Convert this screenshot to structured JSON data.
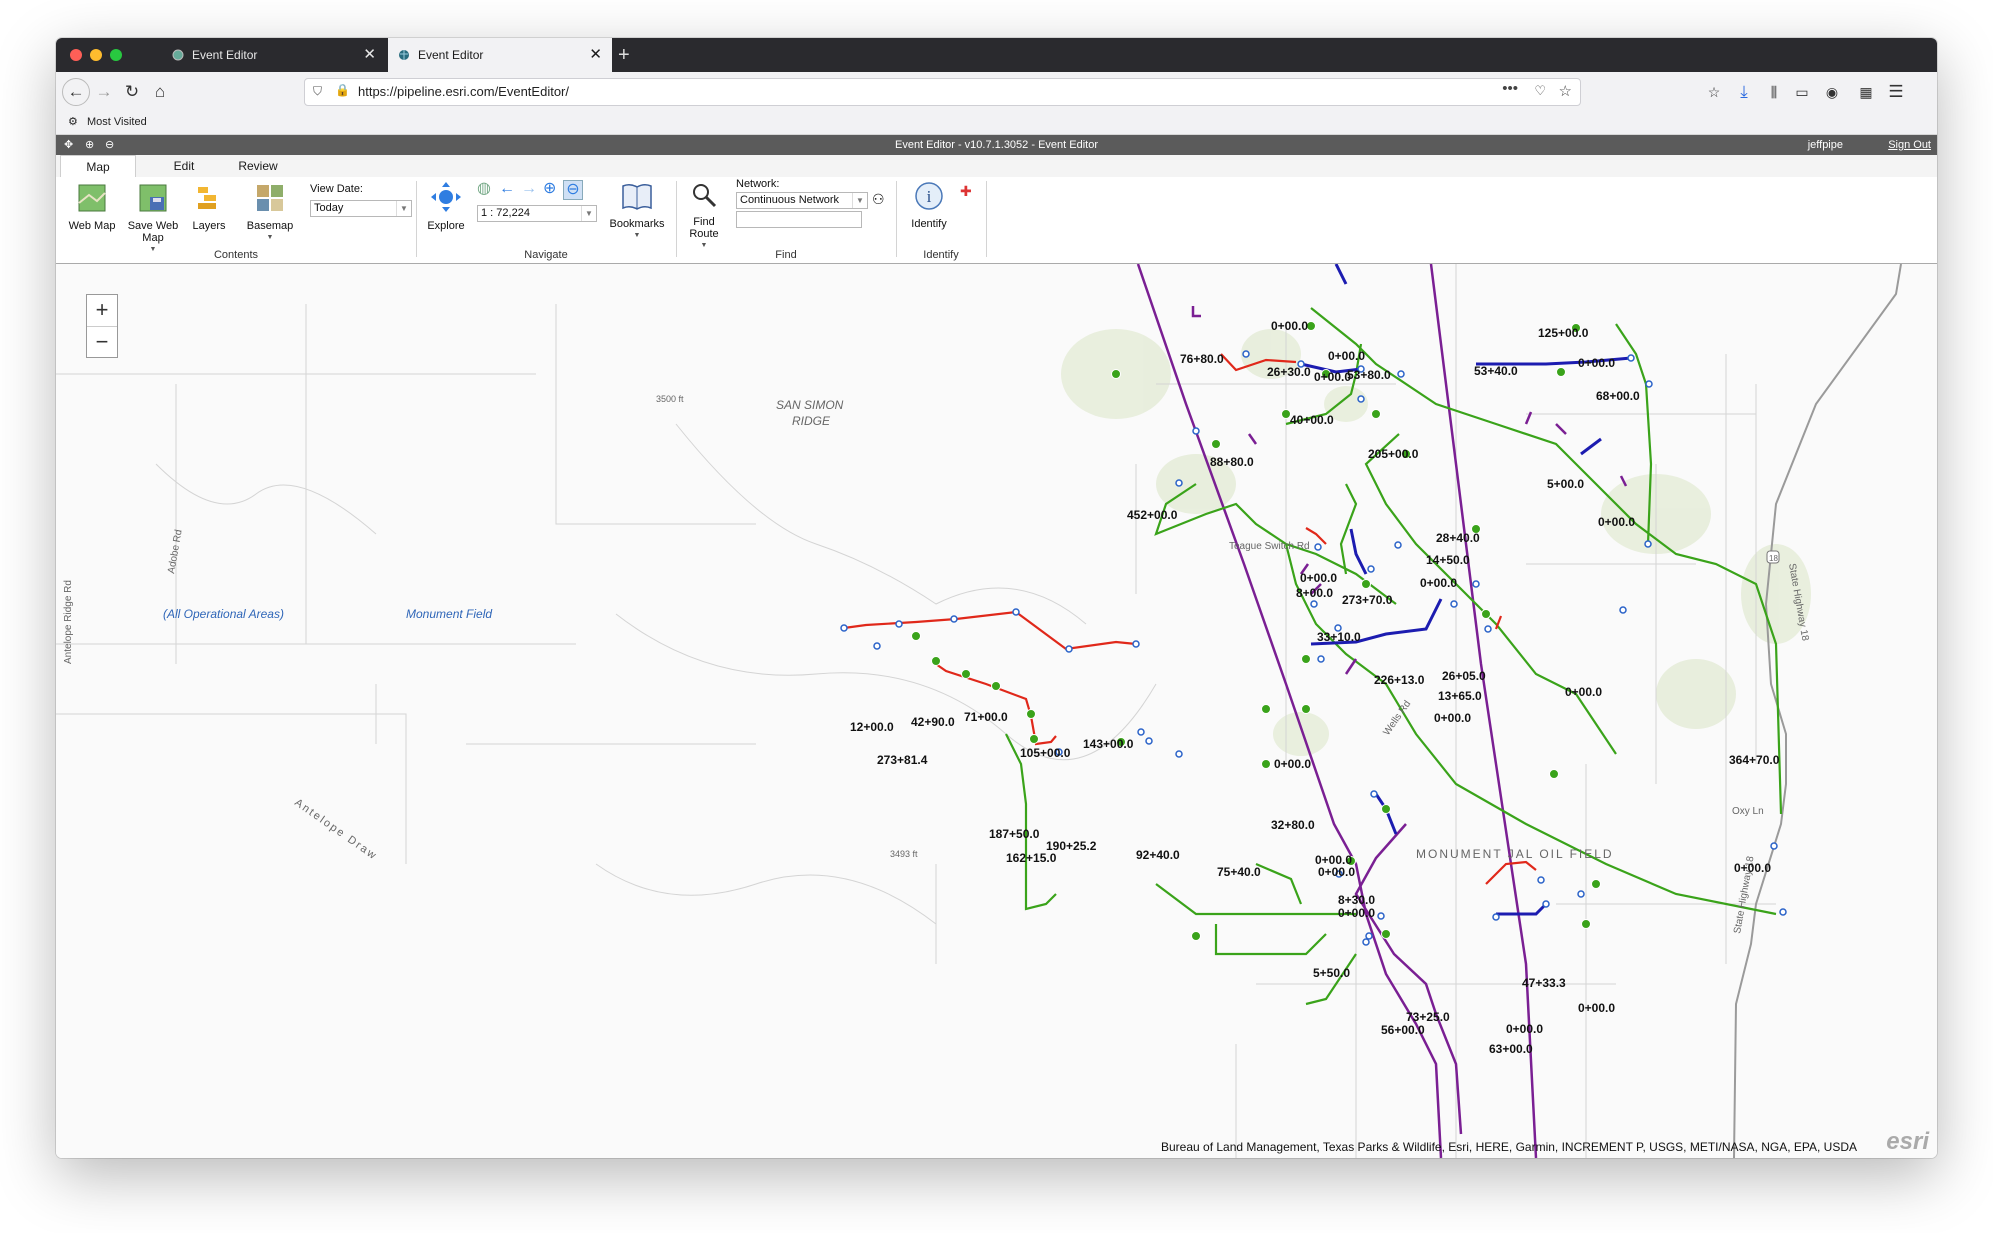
{
  "browser": {
    "tabs": [
      {
        "title": "Event Editor",
        "active": false
      },
      {
        "title": "Event Editor",
        "active": true
      }
    ],
    "url": "https://pipeline.esri.com/EventEditor/",
    "bookmarks_bar": {
      "most_visited": "Most Visited"
    }
  },
  "app": {
    "title": "Event Editor - v10.7.1.3052 - Event Editor",
    "user": "jeffpipe",
    "sign_out": "Sign Out"
  },
  "ribbon": {
    "tabs": [
      "Map",
      "Edit",
      "Review"
    ],
    "active_tab": "Map",
    "contents": {
      "web_map": "Web Map",
      "save_web_map": "Save Web Map",
      "layers": "Layers",
      "basemap": "Basemap",
      "view_date_label": "View Date:",
      "view_date_value": "Today",
      "group": "Contents"
    },
    "navigate": {
      "explore": "Explore",
      "scale_value": "1 : 72,224",
      "bookmarks": "Bookmarks",
      "group": "Navigate"
    },
    "find": {
      "find_route": "Find Route",
      "network_label": "Network:",
      "network_value": "Continuous Network",
      "search_value": "",
      "group": "Find"
    },
    "identify": {
      "identify": "Identify",
      "group": "Identify"
    }
  },
  "map": {
    "place_labels": {
      "san_simon": "SAN SIMON",
      "ridge": "RIDGE",
      "all_areas": "(All Operational Areas)",
      "monument_field": "Monument Field",
      "oil_field": "MONUMENT JAL OIL FIELD",
      "elev1": "3500 ft",
      "elev2": "3493 ft",
      "adobe_rd": "Adobe Rd",
      "antelope_ridge": "Antelope Ridge Rd",
      "antelope_draw": "Antelope Draw",
      "teague": "Teague Switch Rd",
      "wells_rd": "Wells Rd",
      "oxy_ln": "Oxy Ln",
      "state_hwy": "State Highway 18",
      "hwy_shield": "18"
    },
    "station_labels": {
      "s1": "0+00.0",
      "s2": "125+00.0",
      "s3": "76+80.0",
      "s4": "0+00.0",
      "s5": "26+30.0",
      "s6": "0+00.0",
      "s7": "53+80.0",
      "s8": "53+40.0",
      "s9": "0+00.0",
      "s10": "68+00.0",
      "s11": "40+00.0",
      "s12": "205+00.0",
      "s13": "88+80.0",
      "s14": "5+00.0",
      "s15": "452+00.0",
      "s16": "0+00.0",
      "s17": "28+40.0",
      "s18": "14+50.0",
      "s19": "0+00.0",
      "s20": "0+00.0",
      "s21": "8+00.0",
      "s22": "273+70.0",
      "s23": "33+10.0",
      "s24": "226+13.0",
      "s25": "26+05.0",
      "s26": "13+65.0",
      "s27": "0+00.0",
      "s28": "0+00.0",
      "s29": "12+00.0",
      "s30": "42+90.0",
      "s31": "71+00.0",
      "s32": "143+00.0",
      "s33": "105+00.0",
      "s34": "273+81.4",
      "s35": "364+70.0",
      "s36": "0+00.0",
      "s37": "32+80.0",
      "s38": "187+50.0",
      "s39": "190+25.2",
      "s40": "162+15.0",
      "s41": "92+40.0",
      "s42": "0+00.0",
      "s43": "0+00.0",
      "s44": "75+40.0",
      "s45": "0+00.0",
      "s46": "8+30.0",
      "s47": "0+00.0",
      "s48": "47+33.3",
      "s49": "5+50.0",
      "s50": "0+00.0",
      "s51": "73+25.0",
      "s52": "56+00.0",
      "s53": "0+00.0",
      "s54": "63+00.0"
    },
    "attribution": "Bureau of Land Management, Texas Parks & Wildlife, Esri, HERE, Garmin, INCREMENT P, USGS, METI/NASA, NGA, EPA, USDA",
    "logo": "esri",
    "colors": {
      "green": "#3aa31a",
      "purple": "#7a1f93",
      "blue": "#1c1cb0",
      "red": "#e0281a"
    }
  }
}
